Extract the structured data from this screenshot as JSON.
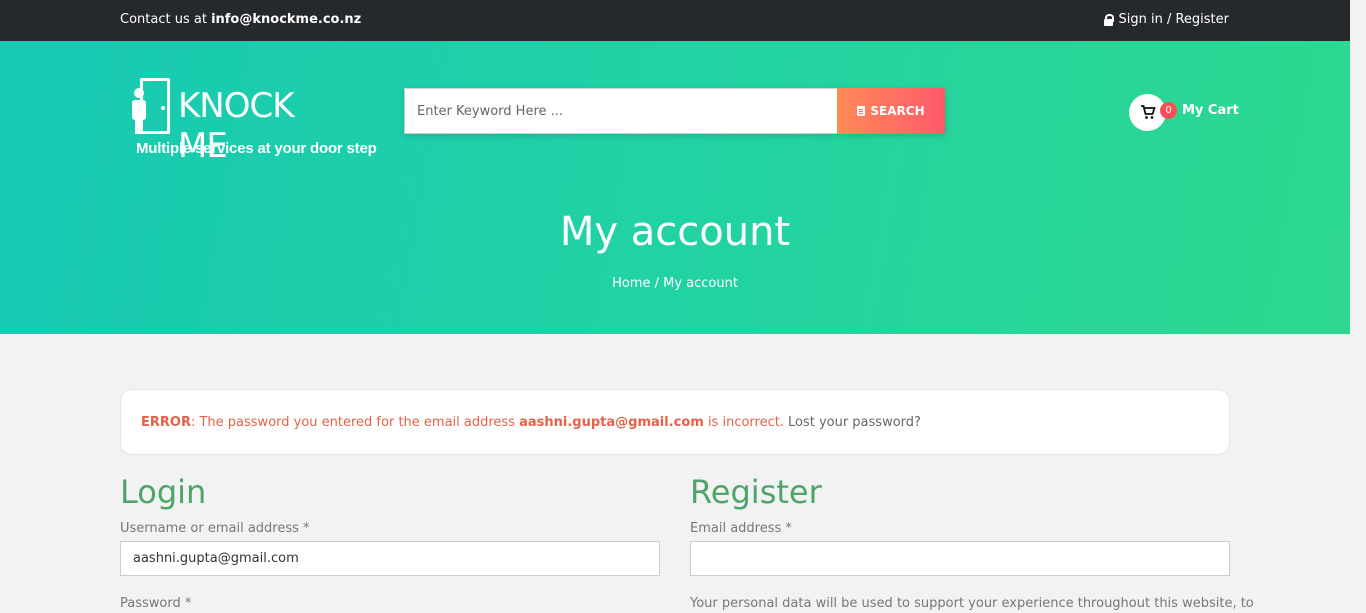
{
  "topbar": {
    "contact_prefix": "Contact us at ",
    "contact_email": "info@knockme.co.nz",
    "signin_label": "Sign in / Register"
  },
  "header": {
    "logo_brand": "KNOCK ME",
    "logo_tagline": "Multiple services at your door step",
    "search": {
      "placeholder": "Enter Keyword Here ...",
      "button_label": "SEARCH"
    },
    "cart": {
      "count": "0",
      "label": "My Cart"
    }
  },
  "page": {
    "title": "My account",
    "breadcrumb": "Home / My account"
  },
  "error": {
    "label": "ERROR",
    "message_before": ": The password you entered for the email address ",
    "email": "aashni.gupta@gmail.com",
    "message_after": " is incorrect.",
    "lost_password": "Lost your password?"
  },
  "login": {
    "heading": "Login",
    "username_label": "Username or email address *",
    "username_value": "aashni.gupta@gmail.com",
    "password_label": "Password *"
  },
  "register": {
    "heading": "Register",
    "email_label": "Email address *",
    "email_value": "",
    "privacy_text": "Your personal data will be used to support your experience throughout this website, to"
  }
}
